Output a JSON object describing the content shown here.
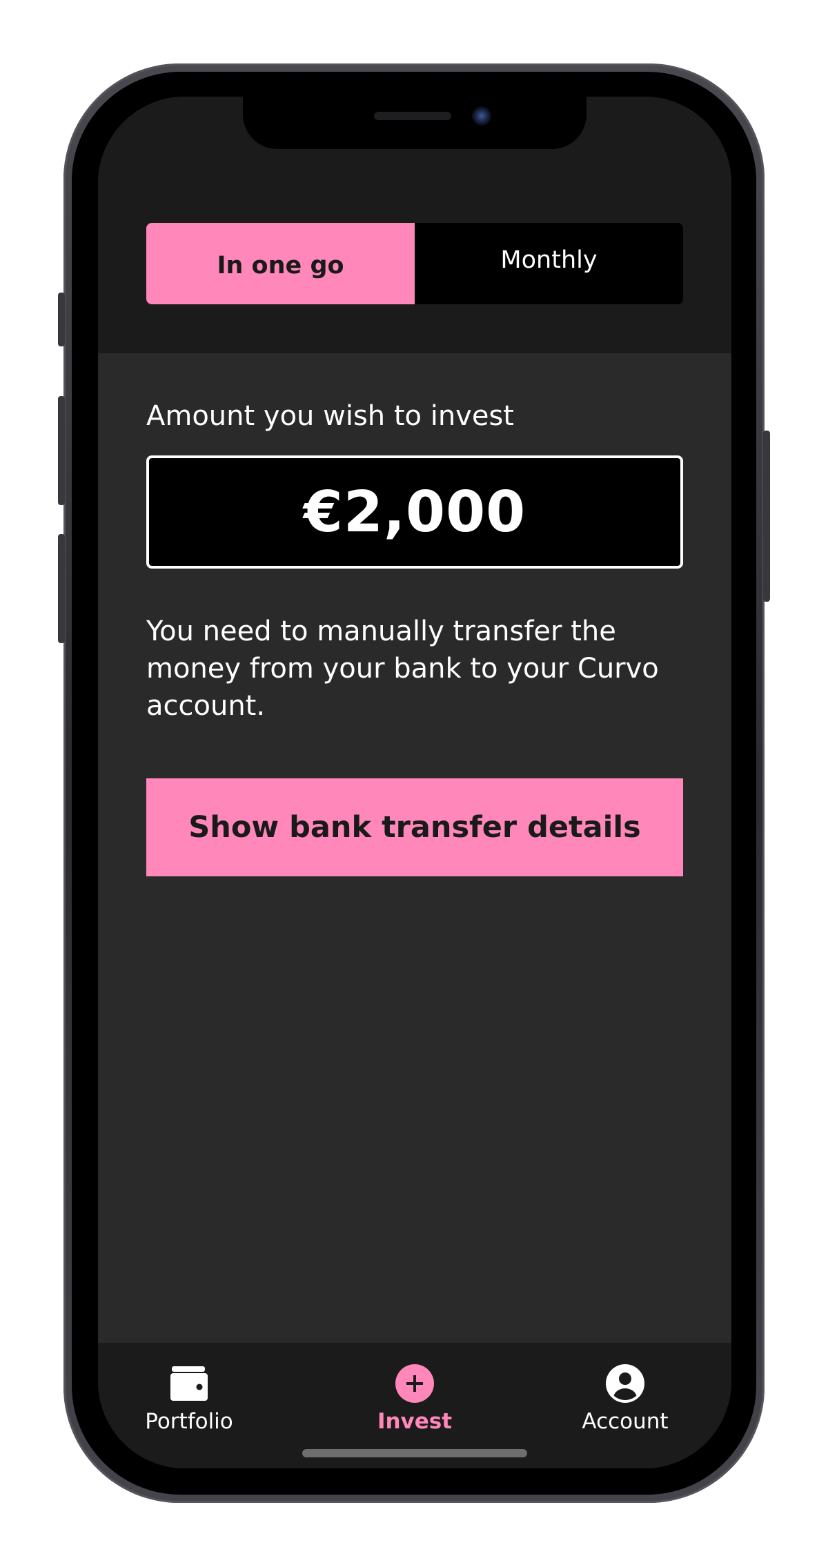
{
  "toggle": {
    "options": [
      {
        "label": "In one go",
        "active": true
      },
      {
        "label": "Monthly",
        "active": false
      }
    ]
  },
  "invest": {
    "amount_label": "Amount you wish to invest",
    "amount_value": "€2,000",
    "info_text": "You need to manually transfer the money from your bank to your Curvo account.",
    "cta_label": "Show bank transfer details"
  },
  "tabbar": {
    "items": [
      {
        "label": "Portfolio",
        "icon": "wallet-icon",
        "active": false
      },
      {
        "label": "Invest",
        "icon": "plus-circle-icon",
        "active": true
      },
      {
        "label": "Account",
        "icon": "user-circle-icon",
        "active": false
      }
    ]
  },
  "colors": {
    "accent": "#ff87ba",
    "background": "#2a2a2b",
    "header_background": "#1b1b1b",
    "input_background": "#000000",
    "text": "#ffffff"
  }
}
